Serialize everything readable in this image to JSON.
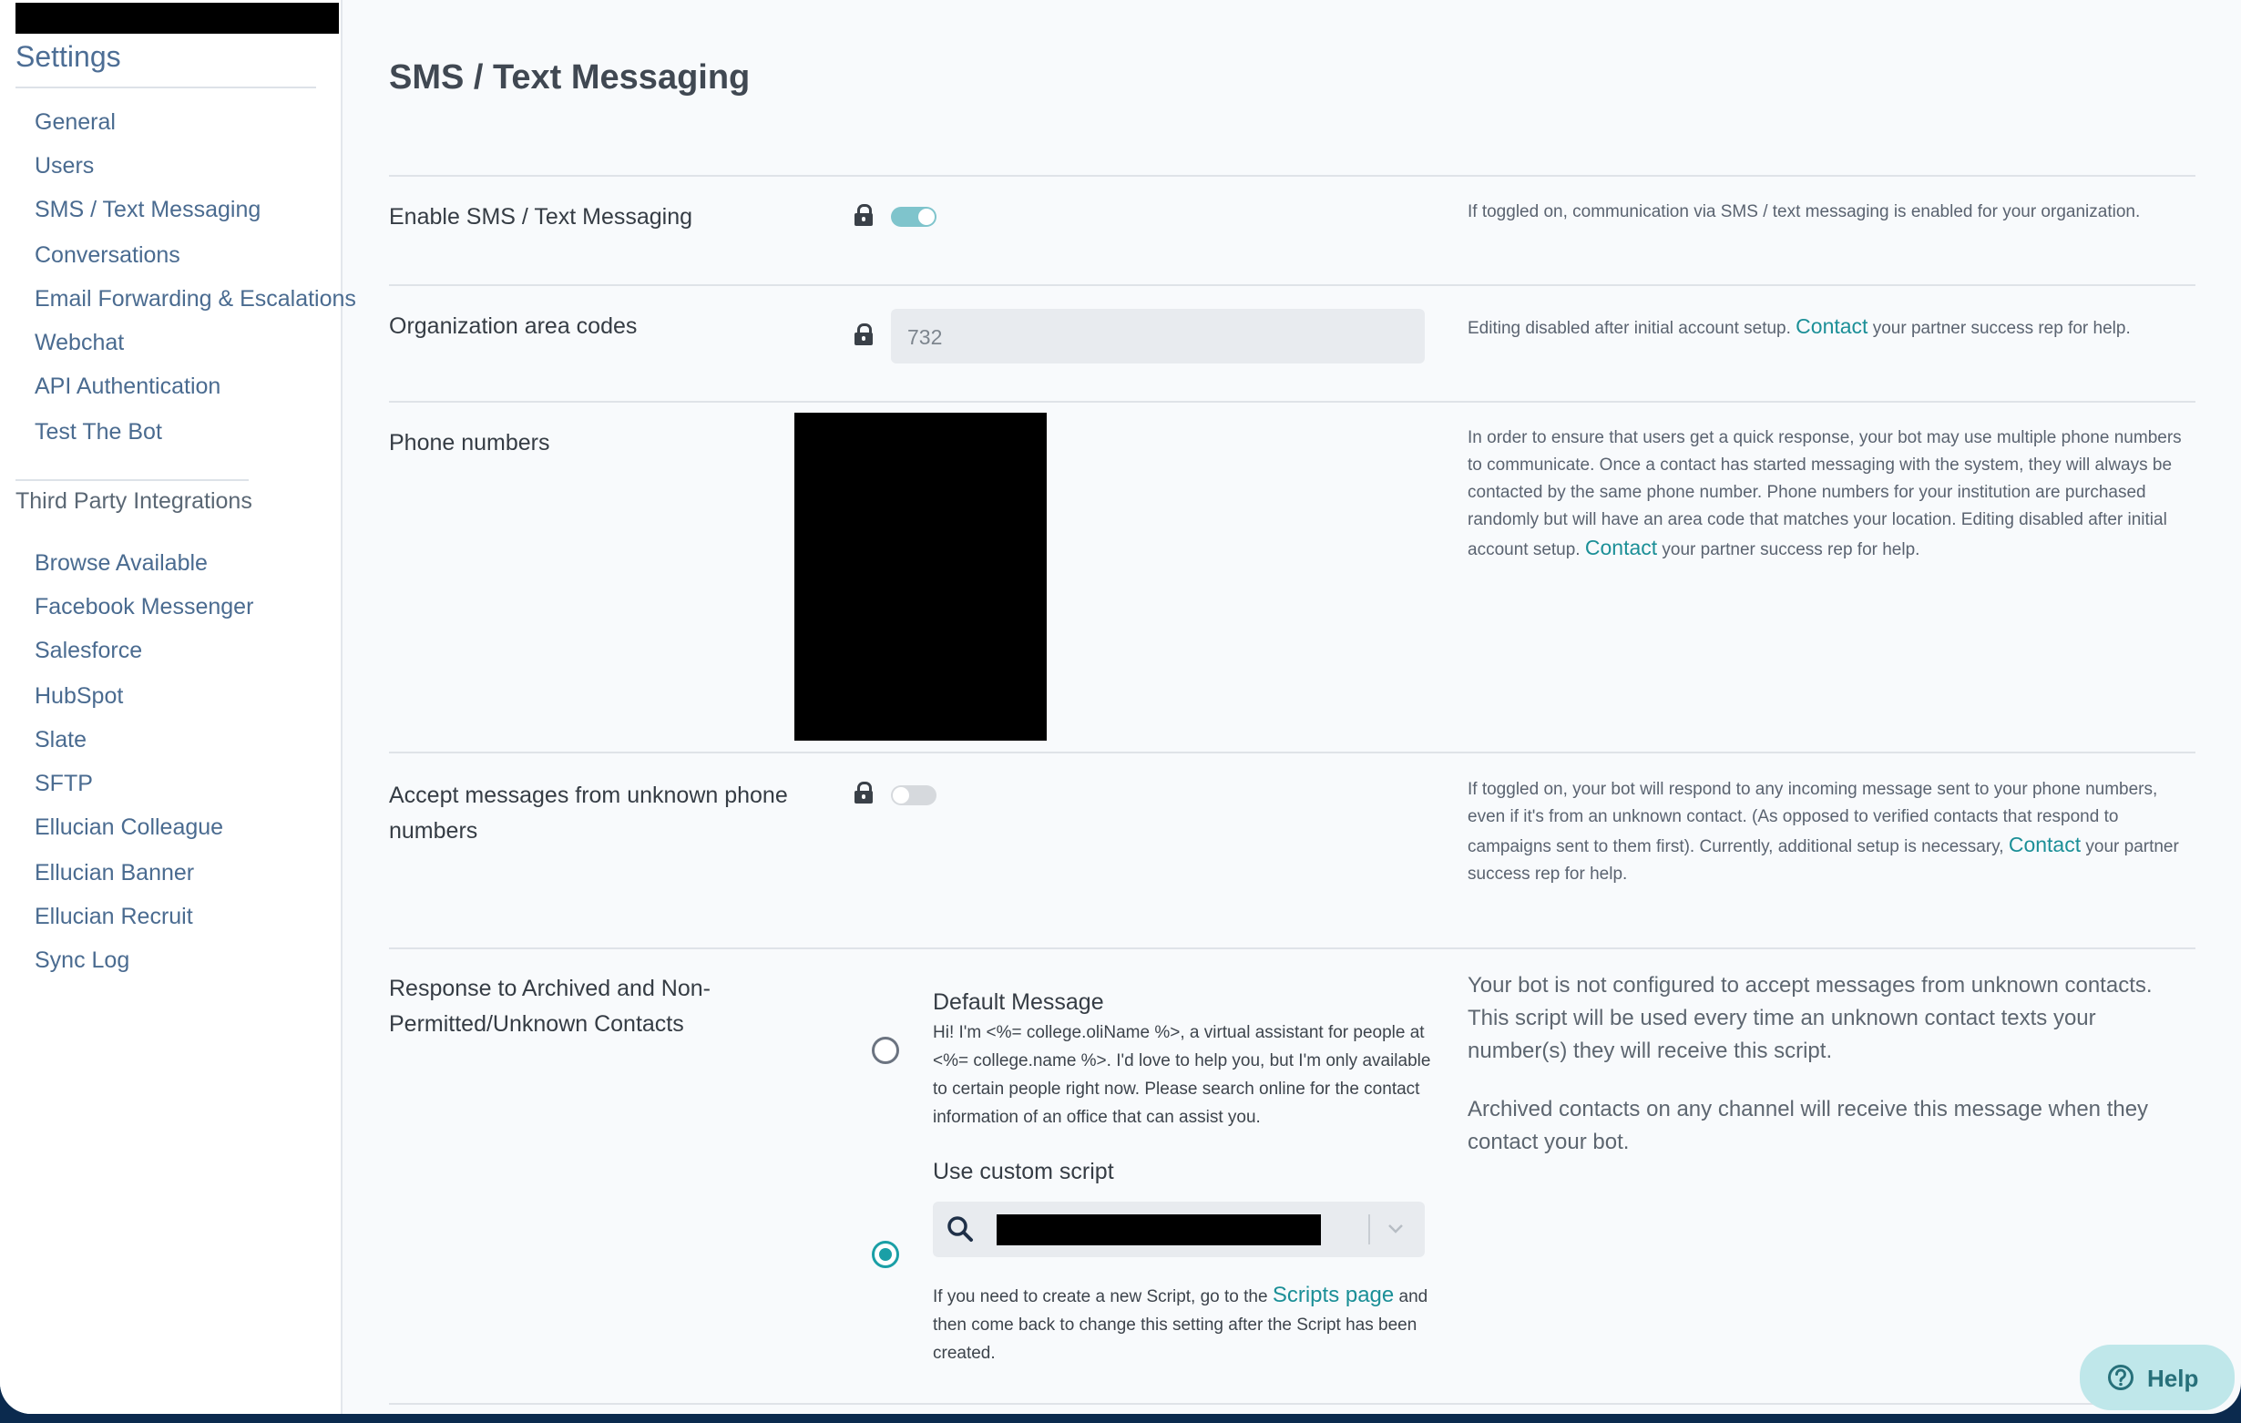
{
  "sidebar": {
    "title": "Settings",
    "items": [
      {
        "label": "General"
      },
      {
        "label": "Users"
      },
      {
        "label": "SMS / Text Messaging"
      },
      {
        "label": "Conversations"
      },
      {
        "label": "Email Forwarding & Escalations"
      },
      {
        "label": "Webchat"
      },
      {
        "label": "API Authentication"
      },
      {
        "label": "Test The Bot"
      }
    ],
    "section_label": "Third Party Integrations",
    "integrations": [
      {
        "label": "Browse Available"
      },
      {
        "label": "Facebook Messenger"
      },
      {
        "label": "Salesforce"
      },
      {
        "label": "HubSpot"
      },
      {
        "label": "Slate"
      },
      {
        "label": "SFTP"
      },
      {
        "label": "Ellucian Colleague"
      },
      {
        "label": "Ellucian Banner"
      },
      {
        "label": "Ellucian Recruit"
      },
      {
        "label": "Sync Log"
      }
    ]
  },
  "main": {
    "title": "SMS / Text Messaging",
    "enable_sms": {
      "label": "Enable SMS / Text Messaging",
      "enabled": true,
      "help": "If toggled on, communication via SMS / text messaging is enabled for your organization."
    },
    "area_codes": {
      "label": "Organization area codes",
      "value": "732",
      "help_before": "Editing disabled after initial account setup.",
      "help_link": "Contact",
      "help_after": "your partner success rep for help."
    },
    "phone_numbers": {
      "label": "Phone numbers",
      "help_before": "In order to ensure that users get a quick response, your bot may use multiple phone numbers to communicate. Once a contact has started messaging with the system, they will always be contacted by the same phone number. Phone numbers for your institution are purchased randomly but will have an area code that matches your location. Editing disabled after initial account setup.",
      "help_link": "Contact",
      "help_after": "your partner success rep for help."
    },
    "unknown_numbers": {
      "label": "Accept messages from unknown phone numbers",
      "enabled": false,
      "help_before": "If toggled on, your bot will respond to any incoming message sent to your phone numbers, even if it's from an unknown contact. (As opposed to verified contacts that respond to campaigns sent to them first). Currently, additional setup is necessary,",
      "help_link": "Contact",
      "help_after": "your partner success rep for help."
    },
    "archived_response": {
      "label": "Response to Archived and Non-Permitted/Unknown Contacts",
      "default_title": "Default Message",
      "default_body": "Hi! I'm <%= college.oliName %>, a virtual assistant for people at <%= college.name %>. I'd love to help you, but I'm only available to certain people right now. Please search online for the contact information of an office that can assist you.",
      "custom_title": "Use custom script",
      "selected": "custom",
      "scripts_note_before": "If you need to create a new Script, go to the",
      "scripts_note_link": "Scripts page",
      "scripts_note_after": "and then come back to change this setting after the Script has been created.",
      "help_1": "Your bot is not configured to accept messages from unknown contacts. This script will be used every time an unknown contact texts your number(s) they will receive this script.",
      "help_2": "Archived contacts on any channel will receive this message when they contact your bot."
    }
  },
  "help_button": {
    "label": "Help",
    "icon": "question-circle-icon"
  },
  "colors": {
    "accent": "#1a9fa6",
    "link": "#1b8f97",
    "toggle_on": "#7fc4cc",
    "sidebar_text": "#4a6b90"
  }
}
